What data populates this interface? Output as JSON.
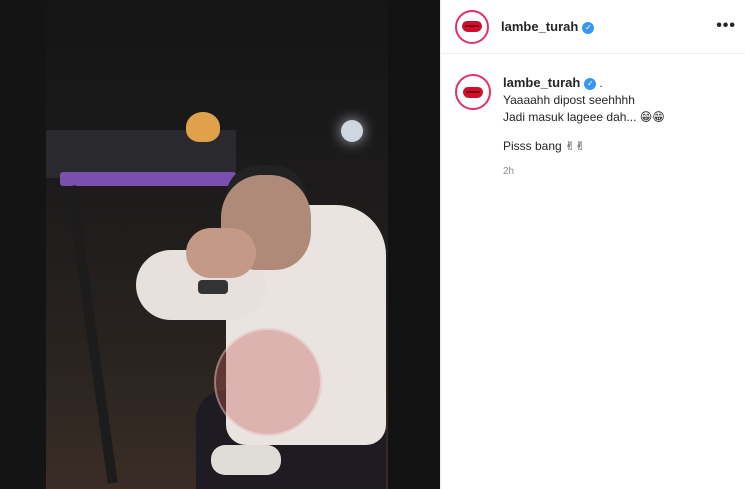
{
  "post": {
    "username": "lambe_turah",
    "verified_mark": "✓",
    "more_icon": "•••"
  },
  "caption": {
    "username": "lambe_turah",
    "verified_mark": "✓",
    "suffix": ".",
    "line1": "Yaaaahh dipost seehhhh",
    "line2": "Jadi masuk lageee dah...",
    "line2_emoji": "😁😁",
    "line3": "Pisss bang",
    "line3_emoji": "✌✌",
    "timestamp": "2h"
  },
  "colors": {
    "verified": "#3897f0",
    "story_ring": "#e1306c",
    "lips": "#d0102b"
  }
}
